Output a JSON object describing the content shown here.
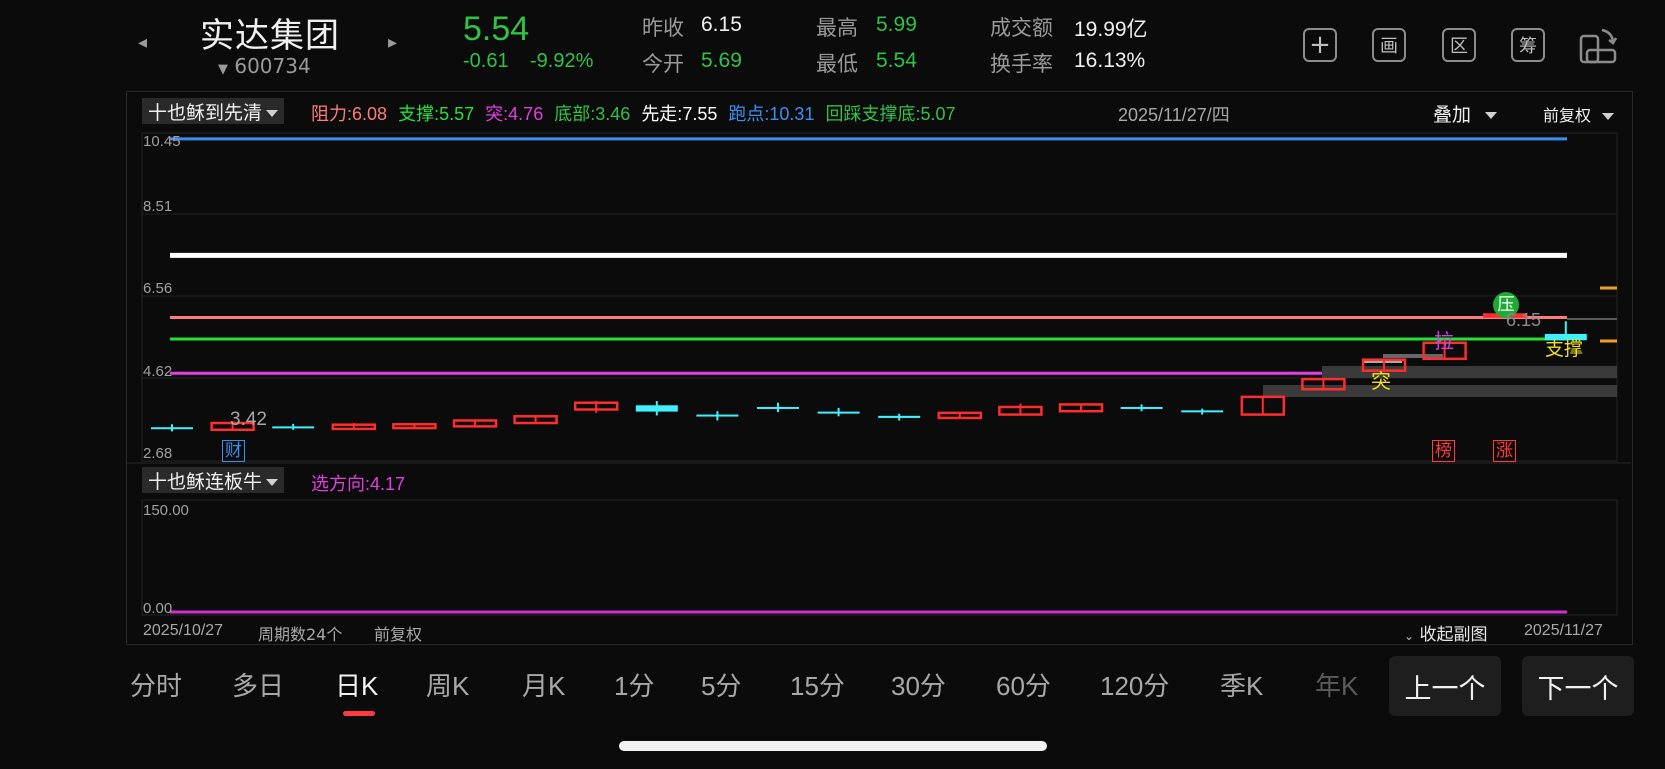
{
  "header": {
    "prev_arrow": "◂",
    "next_arrow": "▸",
    "name": "实达集团",
    "code": "600734",
    "price": "5.54",
    "change": "-0.61",
    "change_pct": "-9.92%",
    "quotes": [
      {
        "label": "昨收",
        "value": "6.15"
      },
      {
        "label": "今开",
        "value": "5.69"
      },
      {
        "label": "最高",
        "value": "5.99"
      },
      {
        "label": "最低",
        "value": "5.54"
      },
      {
        "label": "成交额",
        "value": "19.99亿"
      },
      {
        "label": "换手率",
        "value": "16.13%"
      }
    ],
    "tools": [
      {
        "name": "add",
        "glyph": "+"
      },
      {
        "name": "draw",
        "glyph": "画"
      },
      {
        "name": "range",
        "glyph": "区"
      },
      {
        "name": "chips",
        "glyph": "筹"
      },
      {
        "name": "rotate",
        "glyph": "⇄"
      }
    ]
  },
  "main_chart": {
    "indicator": "十也稣到先清",
    "legend": [
      {
        "label": "阻力:",
        "value": "6.08",
        "color": "#ff7a7a"
      },
      {
        "label": "支撑:",
        "value": "5.57",
        "color": "#24e03a"
      },
      {
        "label": "突:",
        "value": "4.76",
        "color": "#e040e0"
      },
      {
        "label": "底部:",
        "value": "3.46",
        "color": "#2fc247"
      },
      {
        "label": "先走:",
        "value": "7.55",
        "color": "#ffffff"
      },
      {
        "label": "跑点:",
        "value": "10.31",
        "color": "#3a8ff0"
      },
      {
        "label": "回踩支撑底:",
        "value": "5.07",
        "color": "#2fc247"
      }
    ],
    "date": "2025/11/27/四",
    "overlay": "叠加",
    "adjust": "前复权",
    "y_labels": [
      "10.45",
      "8.51",
      "6.56",
      "4.62",
      "2.68"
    ],
    "annotations": {
      "low_value": "3.42",
      "last_close": "6.15",
      "cai": "财",
      "bang": "榜",
      "zhang": "涨",
      "la": "拉",
      "tu": "突",
      "ya": "压",
      "zhicheng": "支撑"
    }
  },
  "chart_data": {
    "type": "candlestick",
    "y_range": [
      2.68,
      10.45
    ],
    "lines": [
      {
        "name": "跑点",
        "value": 10.31,
        "color": "#3a8ff0"
      },
      {
        "name": "先走",
        "value": 7.55,
        "color": "#ffffff"
      },
      {
        "name": "阻力",
        "value": 6.08,
        "color": "#ff7a7a"
      },
      {
        "name": "支撑",
        "value": 5.57,
        "color": "#24e03a"
      },
      {
        "name": "突",
        "value": 4.76,
        "color": "#e040e0"
      }
    ],
    "candles": [
      {
        "o": 3.48,
        "h": 3.55,
        "l": 3.38,
        "c": 3.46
      },
      {
        "o": 3.42,
        "h": 3.62,
        "l": 3.42,
        "c": 3.58
      },
      {
        "o": 3.5,
        "h": 3.56,
        "l": 3.42,
        "c": 3.48
      },
      {
        "o": 3.44,
        "h": 3.58,
        "l": 3.42,
        "c": 3.54
      },
      {
        "o": 3.46,
        "h": 3.56,
        "l": 3.44,
        "c": 3.55
      },
      {
        "o": 3.5,
        "h": 3.66,
        "l": 3.49,
        "c": 3.64
      },
      {
        "o": 3.58,
        "h": 3.76,
        "l": 3.58,
        "c": 3.74
      },
      {
        "o": 3.9,
        "h": 4.1,
        "l": 3.82,
        "c": 4.06
      },
      {
        "o": 4.0,
        "h": 4.1,
        "l": 3.76,
        "c": 3.85
      },
      {
        "o": 3.78,
        "h": 3.86,
        "l": 3.64,
        "c": 3.75
      },
      {
        "o": 3.96,
        "h": 4.06,
        "l": 3.84,
        "c": 3.92
      },
      {
        "o": 3.85,
        "h": 3.94,
        "l": 3.74,
        "c": 3.82
      },
      {
        "o": 3.75,
        "h": 3.8,
        "l": 3.64,
        "c": 3.7
      },
      {
        "o": 3.7,
        "h": 3.84,
        "l": 3.7,
        "c": 3.82
      },
      {
        "o": 3.78,
        "h": 4.04,
        "l": 3.76,
        "c": 3.96
      },
      {
        "o": 3.86,
        "h": 4.04,
        "l": 3.84,
        "c": 4.02
      },
      {
        "o": 3.96,
        "h": 4.02,
        "l": 3.86,
        "c": 3.92
      },
      {
        "o": 3.88,
        "h": 3.92,
        "l": 3.78,
        "c": 3.84
      },
      {
        "o": 3.78,
        "h": 4.22,
        "l": 3.78,
        "c": 4.2
      },
      {
        "o": 4.38,
        "h": 4.62,
        "l": 4.36,
        "c": 4.62
      },
      {
        "o": 4.82,
        "h": 5.08,
        "l": 4.82,
        "c": 5.08
      },
      {
        "o": 5.1,
        "h": 5.5,
        "l": 5.08,
        "c": 5.48
      },
      {
        "o": 6.15,
        "h": 6.18,
        "l": 6.1,
        "c": 6.15
      },
      {
        "o": 5.69,
        "h": 5.99,
        "l": 5.54,
        "c": 5.54
      }
    ]
  },
  "sub_chart": {
    "indicator": "十也稣连板牛",
    "legend_label": "选方向:",
    "legend_value": "4.17",
    "y_top": "150.00",
    "y_bottom": "0.00"
  },
  "footer": {
    "start_date": "2025/10/27",
    "period_count": "周期数24个",
    "adjust": "前复权",
    "collapse": "收起副图",
    "end_date": "2025/11/27"
  },
  "periods": [
    "分时",
    "多日",
    "日K",
    "周K",
    "月K",
    "1分",
    "5分",
    "15分",
    "30分",
    "60分",
    "120分",
    "季K",
    "年K"
  ],
  "active_period": "日K",
  "nav": {
    "prev": "上一个",
    "next": "下一个"
  }
}
